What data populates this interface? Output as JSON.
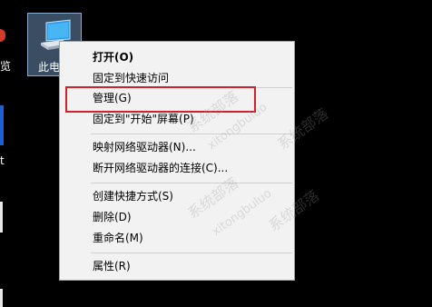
{
  "desktop": {
    "left_edge_labels": [
      "览",
      "t"
    ],
    "this_pc_icon": {
      "label": "此电脑",
      "icon": "computer-icon"
    }
  },
  "context_menu": {
    "items": [
      {
        "label": "打开(O)",
        "bold": true
      },
      {
        "label": "固定到快速访问"
      },
      {
        "label": "管理(G)",
        "highlighted": true
      },
      {
        "label": "固定到\"开始\"屏幕(P)"
      },
      {
        "label": "映射网络驱动器(N)..."
      },
      {
        "label": "断开网络驱动器的连接(C)..."
      },
      {
        "label": "创建快捷方式(S)"
      },
      {
        "label": "删除(D)"
      },
      {
        "label": "重命名(M)"
      },
      {
        "label": "属性(R)"
      }
    ],
    "highlight_color": "#d0222a"
  },
  "watermark": {
    "text_cn": "系统部落",
    "text_en": "xitongbuluo"
  }
}
